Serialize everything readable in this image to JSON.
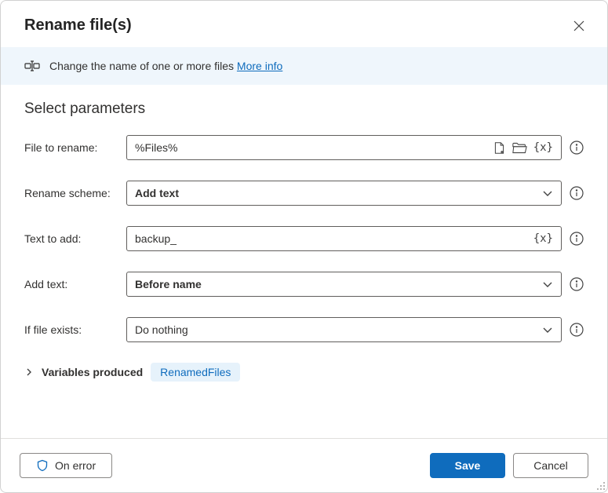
{
  "dialog": {
    "title": "Rename file(s)"
  },
  "banner": {
    "text": "Change the name of one or more files",
    "more_info": "More info"
  },
  "section": {
    "title": "Select parameters"
  },
  "fields": {
    "file_to_rename": {
      "label": "File to rename:",
      "value": "%Files%"
    },
    "rename_scheme": {
      "label": "Rename scheme:",
      "value": "Add text"
    },
    "text_to_add": {
      "label": "Text to add:",
      "value": "backup_"
    },
    "add_text": {
      "label": "Add text:",
      "value": "Before name"
    },
    "if_file_exists": {
      "label": "If file exists:",
      "value": "Do nothing"
    }
  },
  "variables": {
    "label": "Variables produced",
    "badge": "RenamedFiles"
  },
  "footer": {
    "on_error": "On error",
    "save": "Save",
    "cancel": "Cancel"
  }
}
